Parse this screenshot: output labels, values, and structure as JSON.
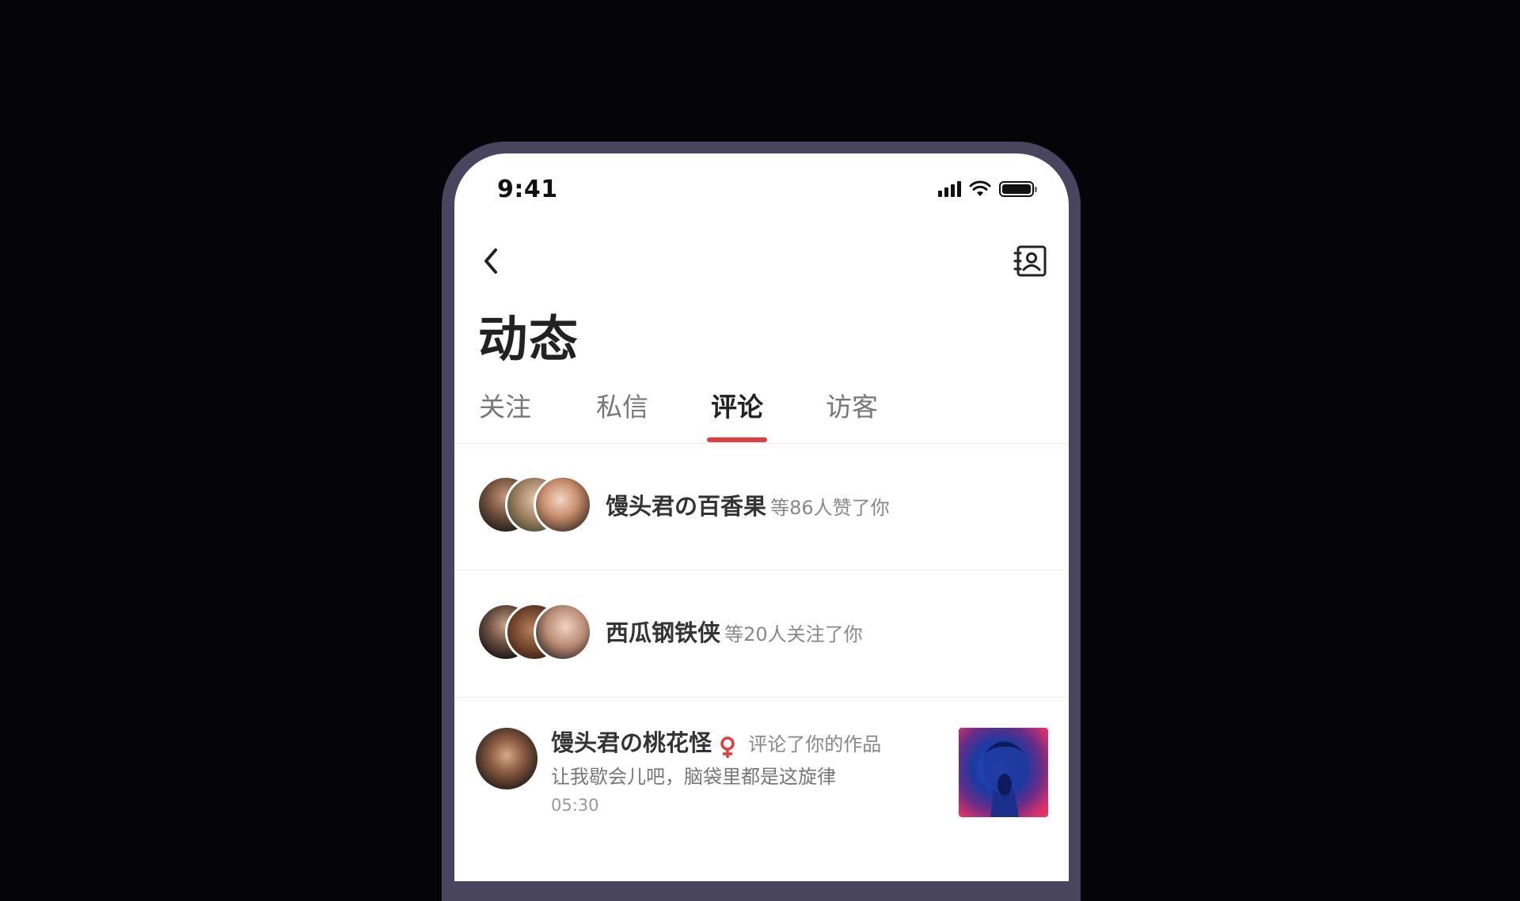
{
  "status_bar": {
    "time": "9:41"
  },
  "header": {
    "title": "动态"
  },
  "tabs": [
    {
      "label": "关注"
    },
    {
      "label": "私信"
    },
    {
      "label": "评论",
      "active": true
    },
    {
      "label": "访客"
    }
  ],
  "notifications": [
    {
      "name": "馒头君の百香果",
      "action": "等86人赞了你"
    },
    {
      "name": "西瓜钢铁侠",
      "action": "等20人关注了你"
    },
    {
      "name": "馒头君の桃花怪",
      "action": "评论了你的作品",
      "comment": "让我歇会儿吧，脑袋里都是这旋律",
      "time": "05:30"
    }
  ],
  "colors": {
    "accent": "#e8393c",
    "frame": "#4a455e",
    "background": "#050508"
  },
  "icons": [
    "back-chevron-icon",
    "contacts-book-icon",
    "female-icon",
    "signal-icon",
    "wifi-icon",
    "battery-icon"
  ]
}
